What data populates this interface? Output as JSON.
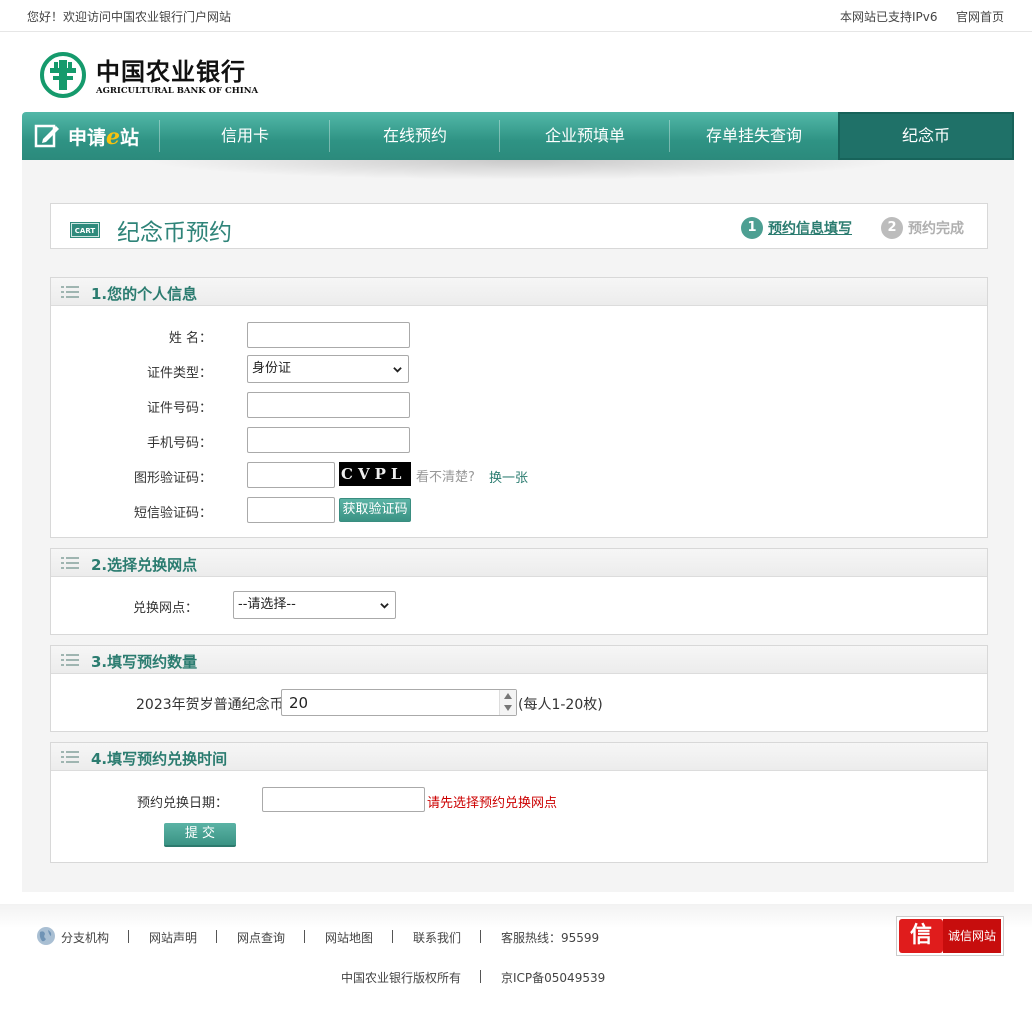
{
  "topbar": {
    "welcome": "您好！欢迎访问中国农业银行门户网站",
    "ipv6": "本网站已支持IPv6",
    "home": "官网首页"
  },
  "logo": {
    "cn": "中国农业银行",
    "en": "AGRICULTURAL BANK OF CHINA"
  },
  "nav": {
    "brand_pre": "申请",
    "brand_e": "e",
    "brand_post": "站",
    "items": [
      "信用卡",
      "在线预约",
      "企业预填单",
      "存单挂失查询",
      "纪念币"
    ],
    "active_index": 4
  },
  "page": {
    "cart_badge": "CART",
    "title": "纪念币预约",
    "steps": [
      {
        "num": "1",
        "label": "预约信息填写",
        "state": "current"
      },
      {
        "num": "2",
        "label": "预约完成",
        "state": "pending"
      }
    ]
  },
  "section1": {
    "title": "1.您的个人信息",
    "name_label": "姓  名：",
    "name_value": "",
    "idtype_label": "证件类型：",
    "idtype_value": "身份证",
    "idno_label": "证件号码：",
    "idno_value": "",
    "phone_label": "手机号码：",
    "phone_value": "",
    "captcha_label": "图形验证码：",
    "captcha_value": "",
    "captcha_text": "CVPL",
    "captcha_unclear": "看不清楚?",
    "captcha_refresh": "换一张",
    "sms_label": "短信验证码：",
    "sms_value": "",
    "sms_button": "获取验证码"
  },
  "section2": {
    "title": "2.选择兑换网点",
    "branch_label": "兑换网点：",
    "branch_value": "--请选择--"
  },
  "section3": {
    "title": "3.填写预约数量",
    "coin_label": "2023年贺岁普通纪念币",
    "quantity": "20",
    "note": "(每人1-20枚)"
  },
  "section4": {
    "title": "4.填写预约兑换时间",
    "date_label": "预约兑换日期：",
    "date_value": "",
    "date_warning": "请先选择预约兑换网点",
    "submit": "提 交"
  },
  "footer": {
    "links": [
      "分支机构",
      "网站声明",
      "网点查询",
      "网站地图",
      "联系我们",
      "客服热线：95599"
    ],
    "trust_icon": "信",
    "trust_label": "诚信网站",
    "copyright": "中国农业银行版权所有",
    "icp": "京ICP备05049539"
  },
  "colors": {
    "brand_green": "#2f9384",
    "text_green": "#2b7c70",
    "warning_red": "#cc0000"
  }
}
